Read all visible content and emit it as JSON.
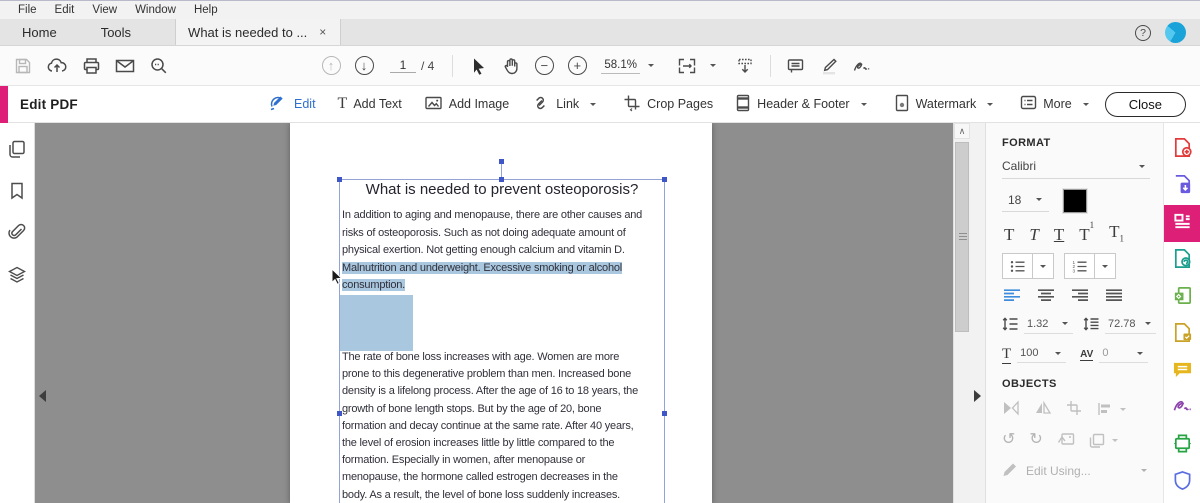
{
  "menu_bar": {
    "items": [
      "File",
      "Edit",
      "View",
      "Window",
      "Help"
    ]
  },
  "tab_bar": {
    "home": "Home",
    "tools": "Tools",
    "document_tab": "What is needed to ...",
    "close_glyph": "×",
    "help_glyph": "?"
  },
  "toolbar": {
    "page_current": "1",
    "page_total": "/ 4",
    "zoom_level": "58.1%"
  },
  "edit_bar": {
    "title": "Edit PDF",
    "edit": "Edit",
    "add_text": "Add Text",
    "add_image": "Add Image",
    "link": "Link",
    "crop_pages": "Crop Pages",
    "header_footer": "Header & Footer",
    "watermark": "Watermark",
    "more": "More",
    "close": "Close"
  },
  "document": {
    "title": "What is needed to prevent osteoporosis?",
    "para1_normal": "In addition to aging and menopause, there are other causes and\nrisks of osteoporosis. Such as not doing adequate amount of\nphysical exertion. Not getting enough calcium and vitamin D.",
    "para1_selected": "Malnutrition and underweight. Excessive smoking or alcohol\nconsumption.",
    "para2": "The rate of bone loss increases with age. Women are more\nprone to this degenerative problem than men. Increased bone\ndensity is a lifelong process. After the age of 16 to 18 years, the\ngrowth of bone length stops. But by the age of 20, bone\nformation and decay continue at the same rate. After 40 years,\nthe level of erosion increases little by little compared to the\nformation. Especially in women, after menopause or\nmenopause, the hormone called estrogen decreases in the\nbody. As a result, the level of bone loss suddenly increases."
  },
  "format_panel": {
    "title": "FORMAT",
    "font_family": "Calibri",
    "font_size": "18",
    "bold": "T",
    "italic": "T",
    "underline": "T",
    "superscript_base": "T",
    "subscript_base": "T",
    "sup_mark": "1",
    "sub_mark": "1",
    "line_spacing": "1.32",
    "paragraph_spacing": "72.78",
    "char_scale_glyph": "T",
    "char_scale": "100",
    "char_spacing_label": "AV",
    "char_spacing": "0",
    "objects_title": "OBJECTS",
    "edit_using": "Edit Using..."
  },
  "icons": {
    "rotate_ccw": "↺",
    "rotate_cw": "↻",
    "scroll_up_chevron": "∧",
    "minus": "−",
    "plus": "+",
    "arrow_up": "↑",
    "arrow_down": "↓"
  },
  "colors": {
    "accent_magenta": "#de1f78",
    "edit_blue": "#2f6fd0",
    "selection_blue": "#a9c7df",
    "canvas_gray": "#8e8e8e"
  }
}
